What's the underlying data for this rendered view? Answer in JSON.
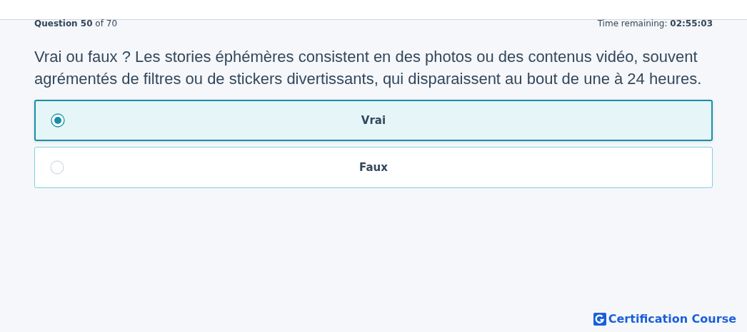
{
  "progress": {
    "label": "Question",
    "number": "50",
    "separator": "of",
    "total": "70"
  },
  "timer": {
    "label": "Time remaining:",
    "value": "02:55:03"
  },
  "question": "Vrai ou faux ? Les stories éphémères consistent en des photos ou des contenus vidéo, souvent agrémentés de filtres ou de stickers divertissants, qui disparaissent au bout de une à 24 heures.",
  "options": [
    {
      "label": "Vrai",
      "selected": true
    },
    {
      "label": "Faux",
      "selected": false
    }
  ],
  "brand": {
    "name": "Certification Course"
  }
}
